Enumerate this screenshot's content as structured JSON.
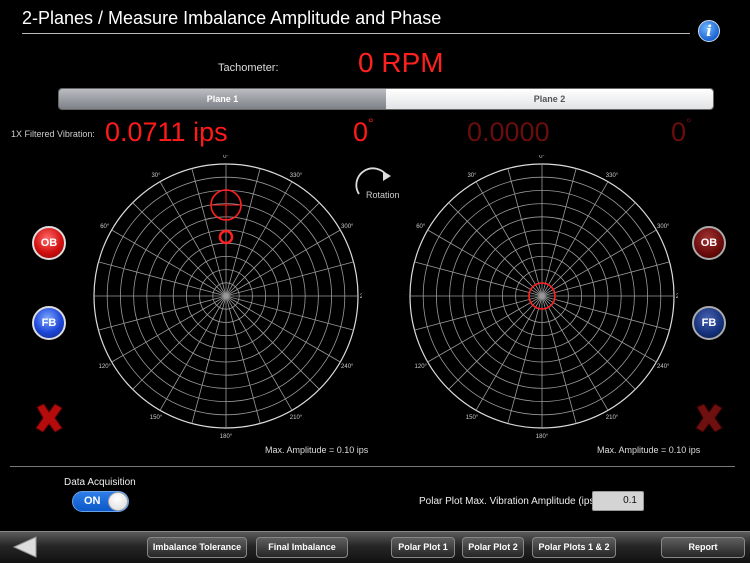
{
  "header": {
    "title": "2-Planes / Measure Imbalance Amplitude and Phase",
    "info_icon": "i"
  },
  "tachometer": {
    "label": "Tachometer:",
    "value": "0 RPM"
  },
  "plane_tabs": [
    {
      "label": "Plane 1",
      "selected": true
    },
    {
      "label": "Plane 2",
      "selected": false
    }
  ],
  "vibration": {
    "label": "1X Filtered Vibration:",
    "plane1": {
      "amplitude": "0.0711 ips",
      "phase": "0",
      "degree": "°"
    },
    "plane2": {
      "amplitude": "0.0000",
      "phase": "0",
      "degree": "°"
    }
  },
  "polar": {
    "angle_labels": [
      "0°",
      "30°",
      "60°",
      "90°",
      "120°",
      "150°",
      "180°",
      "210°",
      "240°",
      "270°",
      "300°",
      "330°"
    ],
    "rotation_label": "Rotation",
    "max_amplitude_1": "Max. Amplitude = 0.10 ips",
    "max_amplitude_2": "Max. Amplitude = 0.10 ips"
  },
  "side_buttons": {
    "ob": "OB",
    "fb": "FB"
  },
  "data_acquisition": {
    "label": "Data Acquisition",
    "state": "ON"
  },
  "polar_max": {
    "label": "Polar Plot Max. Vibration Amplitude (ips):",
    "value": "0.1"
  },
  "toolbar": {
    "imbalance_tolerance": "Imbalance Tolerance",
    "final_imbalance": "Final Imbalance",
    "polar_plot_1": "Polar Plot 1",
    "polar_plot_2": "Polar Plot 2",
    "polar_plots_1_2": "Polar Plots 1 & 2",
    "report": "Report"
  },
  "colors": {
    "accent_red": "#ff1a1a",
    "dim_red": "#6a0d0d",
    "toggle_blue": "#0b58c8"
  }
}
